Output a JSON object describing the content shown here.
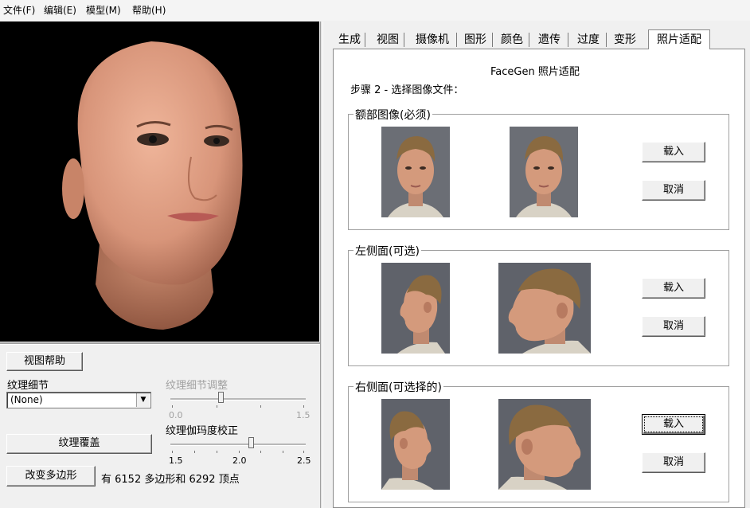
{
  "menu": [
    "文件(F)",
    "编辑(E)",
    "模型(M)",
    "帮助(H)"
  ],
  "left": {
    "view_help": "视图帮助",
    "texture_detail_label": "纹理细节",
    "texture_detail_value": "(None)",
    "texture_detail_adjust_label": "纹理细节调整",
    "texture_detail_ticks": [
      "0.0",
      "1.5"
    ],
    "texture_detail_adjust_value": 0.55,
    "texture_overlay_button": "纹理覆盖",
    "gamma_label": "纹理伽玛度校正",
    "gamma_ticks": [
      "1.5",
      "2.0",
      "2.5"
    ],
    "gamma_value": 2.1,
    "change_poly_button": "改变多边形",
    "poly_info": "有 6152 多边形和 6292 顶点"
  },
  "tabs": [
    "生成",
    "视图",
    "摄像机",
    "图形",
    "颜色",
    "遗传",
    "过度",
    "变形",
    "照片适配"
  ],
  "active_tab": "照片适配",
  "panel": {
    "title": "FaceGen 照片适配",
    "step": "步骤 2 - 选择图像文件：",
    "groups": [
      {
        "title": "额部图像(必须)",
        "load": "载入",
        "cancel": "取消"
      },
      {
        "title": "左侧面(可选)",
        "load": "载入",
        "cancel": "取消"
      },
      {
        "title": "右侧面(可选择的)",
        "load": "载入",
        "cancel": "取消"
      }
    ]
  }
}
